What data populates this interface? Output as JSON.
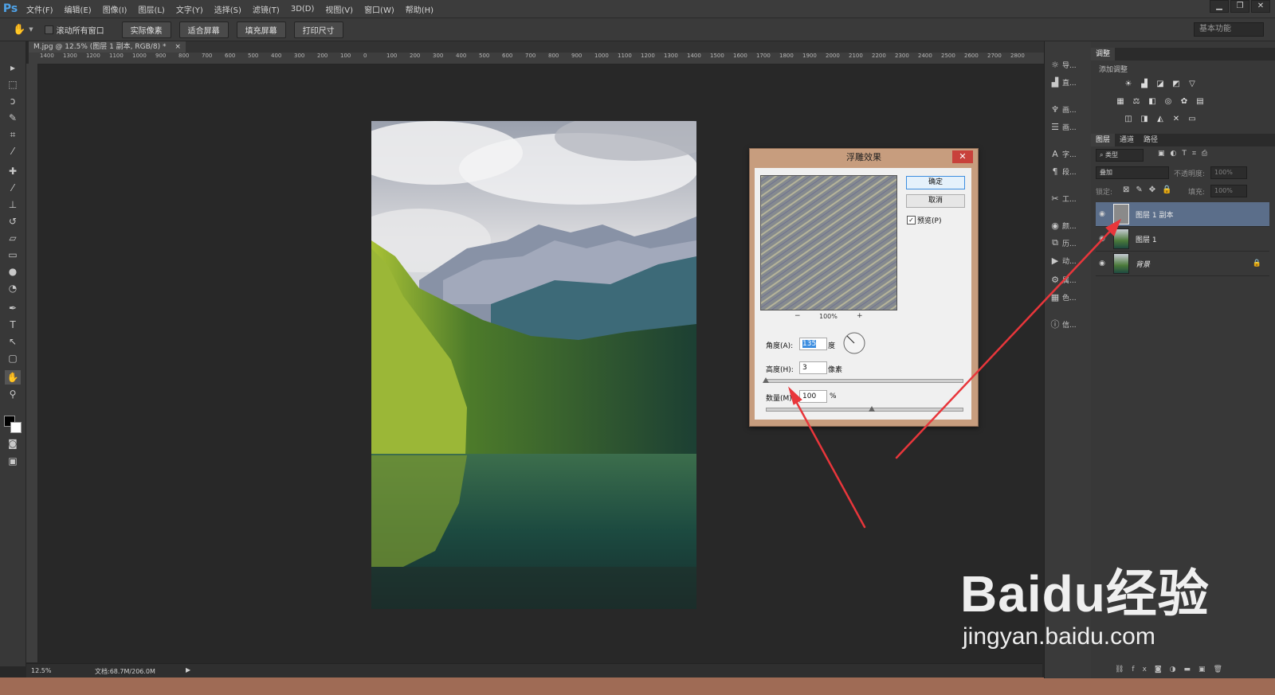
{
  "app": {
    "logo": "Ps"
  },
  "menubar": {
    "items": [
      "文件(F)",
      "编辑(E)",
      "图像(I)",
      "图层(L)",
      "文字(Y)",
      "选择(S)",
      "滤镜(T)",
      "3D(D)",
      "视图(V)",
      "窗口(W)",
      "帮助(H)"
    ]
  },
  "window_controls": [
    "minimize-icon",
    "restore-icon",
    "close-icon"
  ],
  "options_bar": {
    "scroll_all_label": "滚动所有窗口",
    "buttons": [
      "实际像素",
      "适合屏幕",
      "填充屏幕",
      "打印尺寸"
    ],
    "workspace": "基本功能"
  },
  "document": {
    "tab_title": "M.jpg @ 12.5% (图层 1 副本, RGB/8) *",
    "tab_close": "×"
  },
  "ruler": {
    "h_labels": [
      "1400",
      "1300",
      "1200",
      "1100",
      "1000",
      "900",
      "800",
      "700",
      "600",
      "500",
      "400",
      "300",
      "200",
      "100",
      "0",
      "100",
      "200",
      "300",
      "400",
      "500",
      "600",
      "700",
      "800",
      "900",
      "1000",
      "1100",
      "1200",
      "1300",
      "1400",
      "1500",
      "1600",
      "1700",
      "1800",
      "1900",
      "2000",
      "2100",
      "2200",
      "2300",
      "2400",
      "2500",
      "2600",
      "2700",
      "2800"
    ]
  },
  "status_bar": {
    "zoom": "12.5%",
    "doc_size": "文档:68.7M/206.0M"
  },
  "toolbox": {
    "tools": [
      "move-tool-icon",
      "marquee-tool-icon",
      "lasso-tool-icon",
      "quick-select-tool-icon",
      "crop-tool-icon",
      "eyedropper-tool-icon",
      "healing-brush-icon",
      "brush-tool-icon",
      "clone-stamp-icon",
      "history-brush-icon",
      "eraser-tool-icon",
      "gradient-tool-icon",
      "blur-tool-icon",
      "dodge-tool-icon",
      "pen-tool-icon",
      "type-tool-icon",
      "path-select-icon",
      "shape-tool-icon",
      "hand-tool-icon",
      "zoom-tool-icon"
    ]
  },
  "icon_column": {
    "items": [
      {
        "icon": "navigator-icon",
        "label": "导..."
      },
      {
        "icon": "histogram-icon",
        "label": "直..."
      },
      {
        "icon": "brush-presets-icon",
        "label": "画..."
      },
      {
        "icon": "brush-panel-icon",
        "label": "画..."
      },
      {
        "icon": "character-icon",
        "label": "字..."
      },
      {
        "icon": "paragraph-icon",
        "label": "段..."
      },
      {
        "icon": "tools-icon",
        "label": "工..."
      },
      {
        "icon": "color-icon",
        "label": "颜..."
      },
      {
        "icon": "history-icon",
        "label": "历..."
      },
      {
        "icon": "actions-icon",
        "label": "动..."
      },
      {
        "icon": "properties-icon",
        "label": "属..."
      },
      {
        "icon": "swatches-icon",
        "label": "色..."
      },
      {
        "icon": "info-icon",
        "label": "信..."
      }
    ]
  },
  "adjustments_panel": {
    "tab": "调整",
    "subtitle": "添加调整"
  },
  "layers_panel": {
    "tabs": [
      "图层",
      "通道",
      "路径"
    ],
    "filter_kind": "类型",
    "blend_mode": "叠加",
    "opacity_label": "不透明度:",
    "opacity_value": "100%",
    "lock_label": "锁定:",
    "fill_label": "填充:",
    "fill_value": "100%",
    "layers": [
      {
        "name": "图层 1 副本",
        "selected": true
      },
      {
        "name": "图层 1",
        "selected": false
      },
      {
        "name": "背景",
        "selected": false,
        "locked": true
      }
    ]
  },
  "emboss_dialog": {
    "title": "浮雕效果",
    "close": "✕",
    "ok_label": "确定",
    "cancel_label": "取消",
    "preview_label": "预览(P)",
    "preview_checked": true,
    "zoom_value": "100%",
    "zoom_minus": "−",
    "zoom_plus": "+",
    "angle_label": "角度(A):",
    "angle_value": "135",
    "angle_unit": "度",
    "height_label": "高度(H):",
    "height_value": "3",
    "height_unit": "像素",
    "amount_label": "数量(M):",
    "amount_value": "100",
    "amount_unit": "%",
    "height_slider_fraction": 0.0,
    "amount_slider_fraction": 0.54
  },
  "watermark": {
    "brand": "Baidu经验",
    "url": "jingyan.baidu.com"
  },
  "colors": {
    "accent_blue": "#4fa3e8",
    "arrow_red": "#e8363b",
    "selected_layer": "#5b6e8a",
    "dialog_frame": "#c79d7e"
  }
}
